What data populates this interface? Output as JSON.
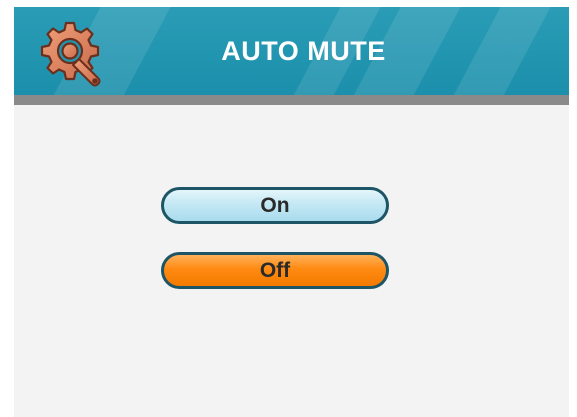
{
  "header": {
    "title": "AUTO MUTE",
    "icon": "settings-gear-wrench-icon"
  },
  "options": [
    {
      "label": "On",
      "selected": false
    },
    {
      "label": "Off",
      "selected": true
    }
  ],
  "colors": {
    "header": "#1f93ae",
    "header_bar": "#8a8a8a",
    "background": "#f3f3f3",
    "option_on": "#c4e8f4",
    "option_selected": "#ff8a12",
    "button_border": "#1e5566"
  }
}
